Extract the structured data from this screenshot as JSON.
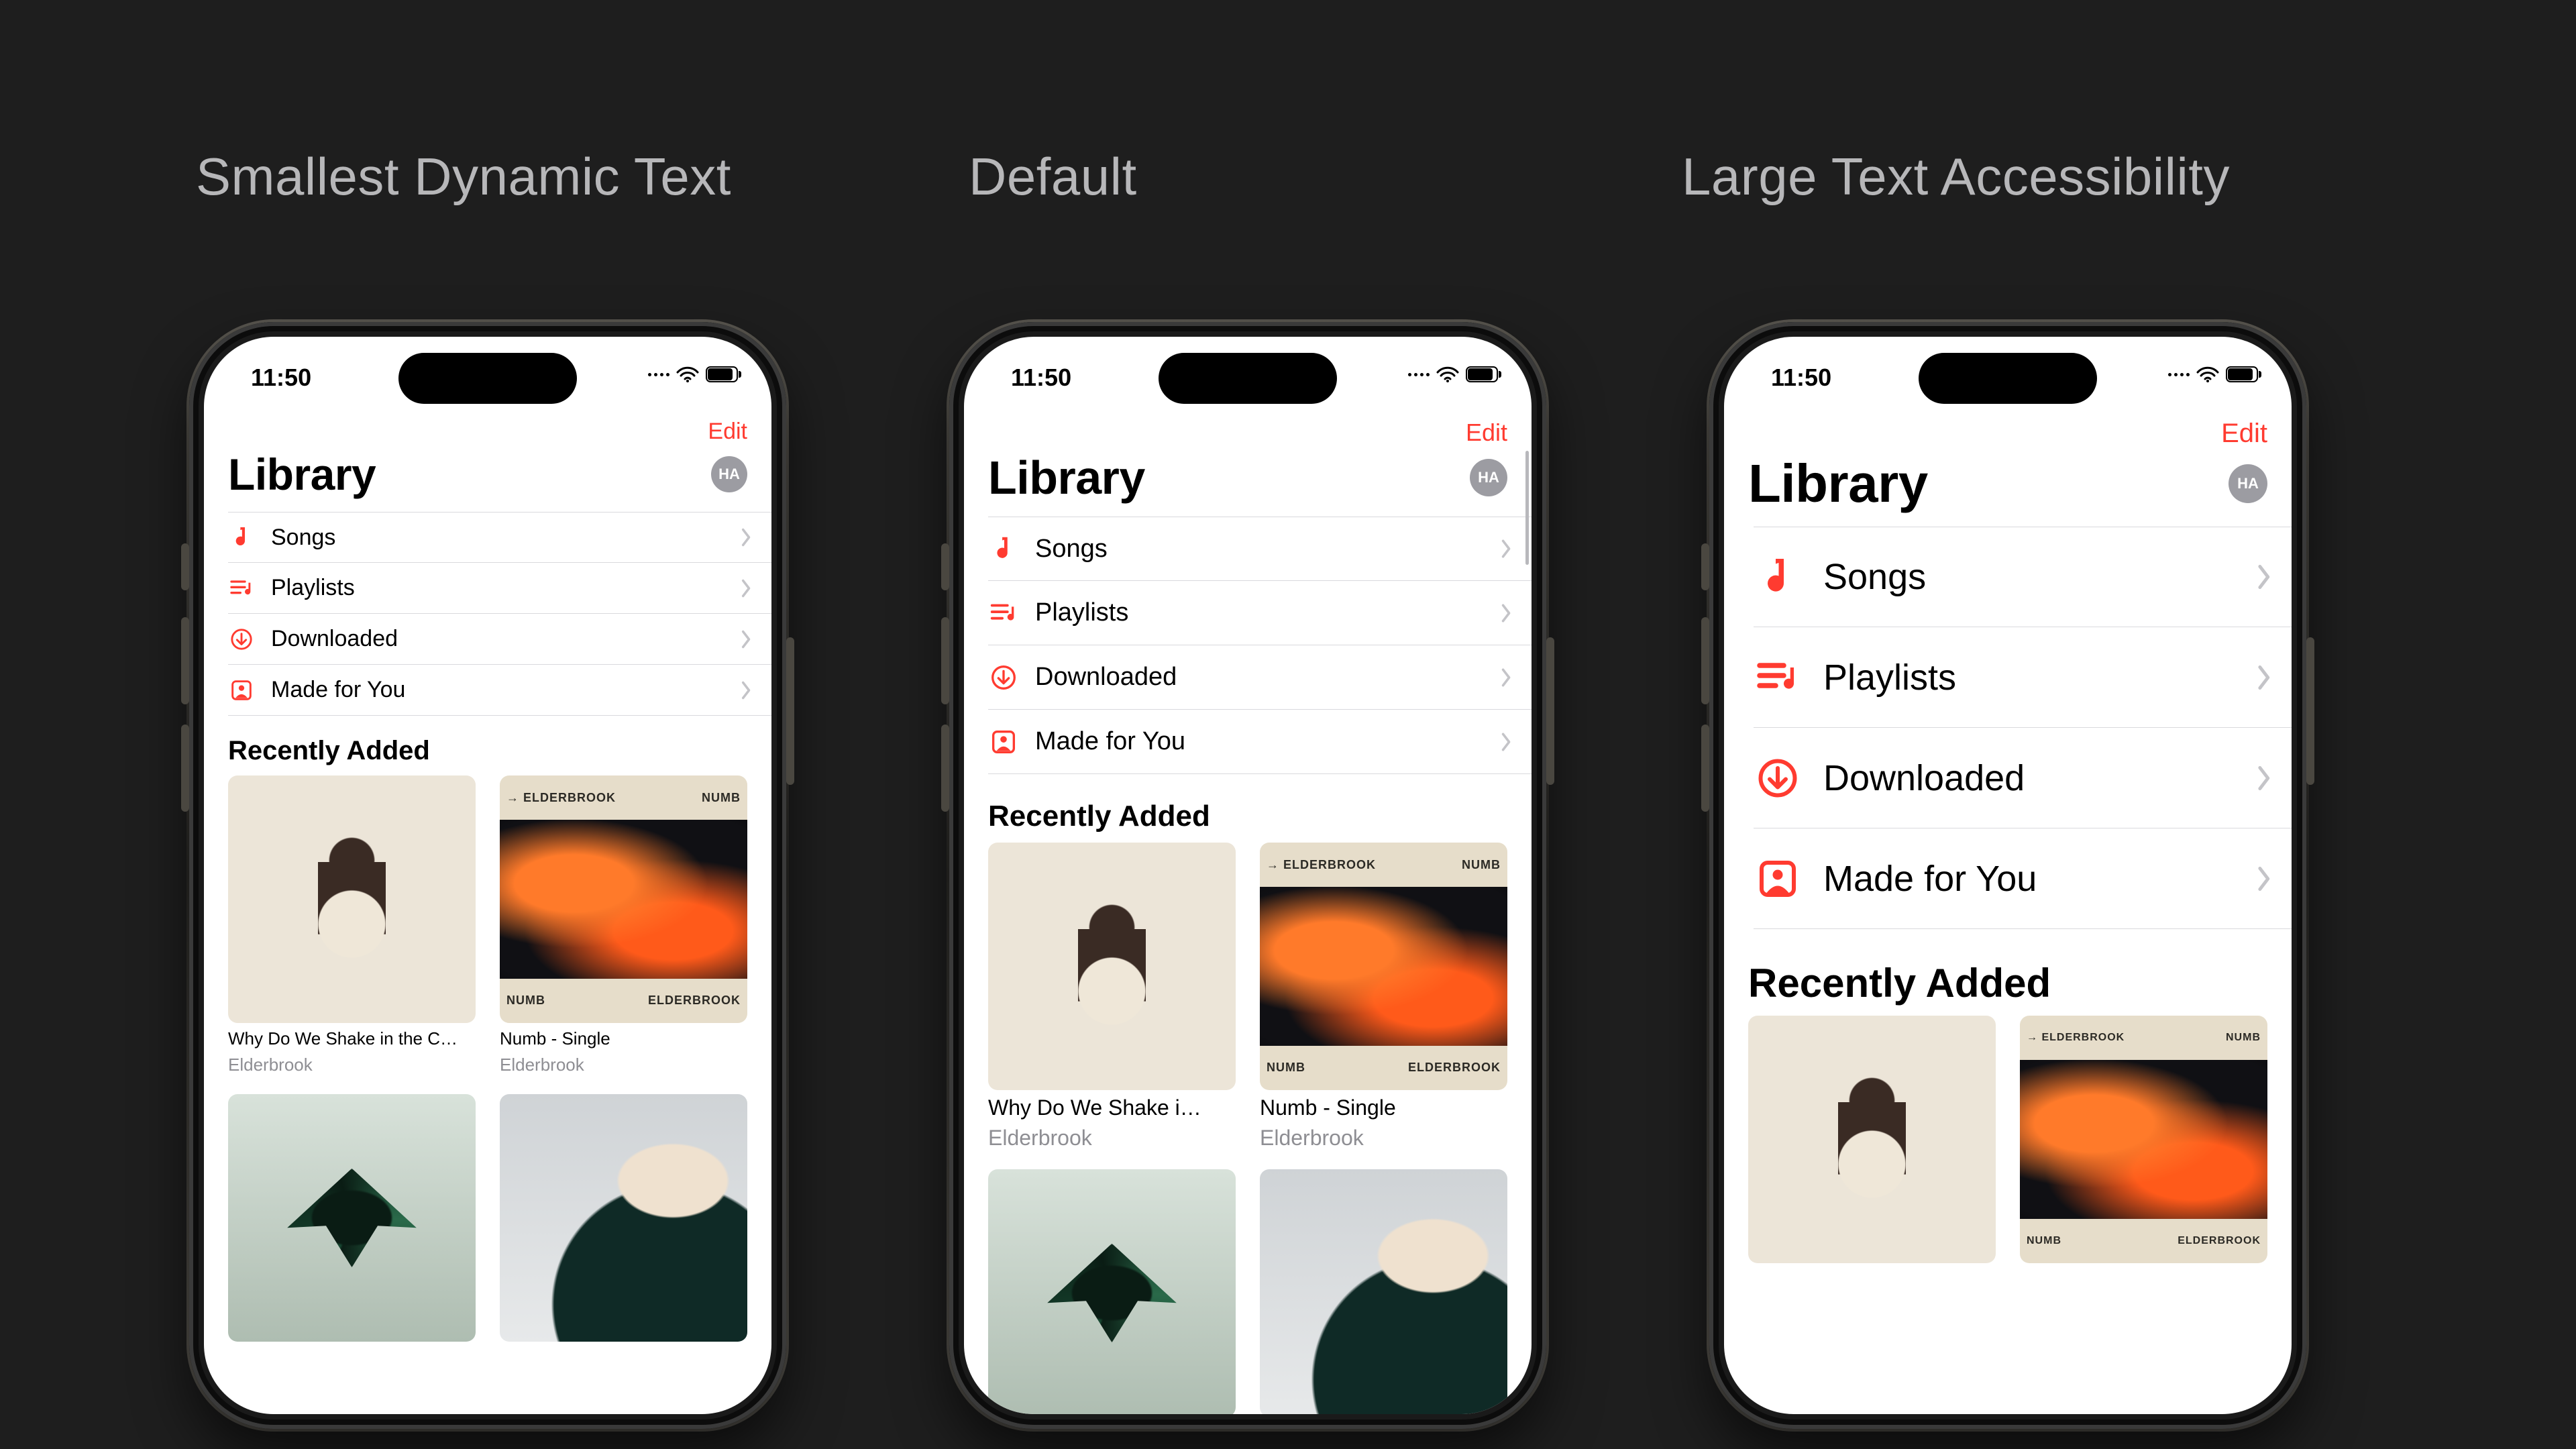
{
  "headings": {
    "smallest": "Smallest Dynamic Text",
    "default": "Default",
    "large": "Large Text Accessibility"
  },
  "colors": {
    "accent": "#ff3b30",
    "grey": "#8e8e93"
  },
  "status": {
    "time": "11:50"
  },
  "nav": {
    "edit": "Edit"
  },
  "title": "Library",
  "avatar": "HA",
  "menu": [
    {
      "key": "songs",
      "label": "Songs",
      "icon": "music-note-icon"
    },
    {
      "key": "playlists",
      "label": "Playlists",
      "icon": "playlist-icon"
    },
    {
      "key": "downloaded",
      "label": "Downloaded",
      "icon": "download-circle-icon"
    },
    {
      "key": "made-for-you",
      "label": "Made for You",
      "icon": "person-frame-icon"
    }
  ],
  "section": "Recently Added",
  "albums": {
    "small": [
      {
        "title": "Why Do We Shake in the C…",
        "artist": "Elderbrook",
        "art": "shake"
      },
      {
        "title": "Numb - Single",
        "artist": "Elderbrook",
        "art": "numb"
      },
      {
        "title": "",
        "artist": "",
        "art": "bird"
      },
      {
        "title": "",
        "artist": "",
        "art": "guy"
      }
    ],
    "default": [
      {
        "title": "Why Do We Shake i…",
        "artist": "Elderbrook",
        "art": "shake"
      },
      {
        "title": "Numb - Single",
        "artist": "Elderbrook",
        "art": "numb"
      },
      {
        "title": "",
        "artist": "",
        "art": "bird"
      },
      {
        "title": "",
        "artist": "",
        "art": "guy"
      }
    ],
    "large": [
      {
        "title": "",
        "artist": "",
        "art": "shake"
      },
      {
        "title": "",
        "artist": "",
        "art": "numb"
      }
    ]
  },
  "numb_text": {
    "top_left": "→ ELDERBROOK",
    "top_right": "NUMB",
    "bot_left": "NUMB",
    "bot_right": "ELDERBROOK"
  }
}
